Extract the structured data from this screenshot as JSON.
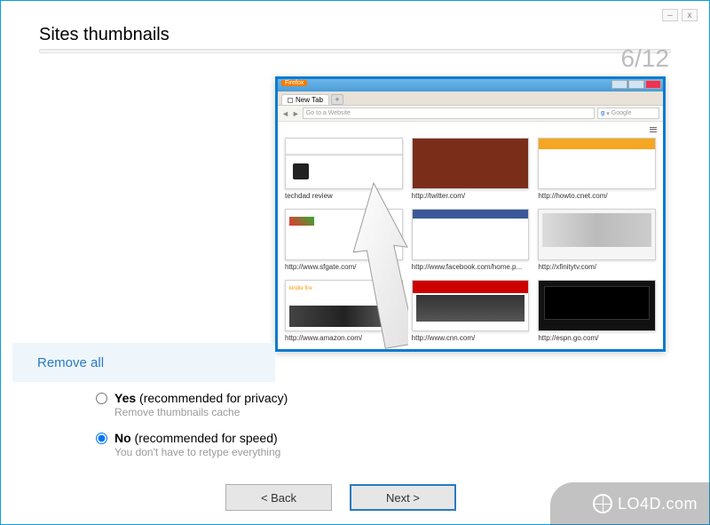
{
  "window": {
    "title": "Sites thumbnails",
    "step_current": 6,
    "step_total": 12,
    "step_display": "6/12"
  },
  "browser": {
    "app_label": "Firefox",
    "tab_label": "New Tab",
    "url_placeholder": "Go to a Website",
    "search_placeholder": "Google",
    "thumbnails": [
      {
        "label": "techdad review"
      },
      {
        "label": "http://twitter.com/"
      },
      {
        "label": "http://howto.cnet.com/"
      },
      {
        "label": "http://www.sfgate.com/"
      },
      {
        "label": "http://www.facebook.com/home.p..."
      },
      {
        "label": "http://xfinitytv.com/"
      },
      {
        "label": "http://www.amazon.com/"
      },
      {
        "label": "http://www.cnn.com/"
      },
      {
        "label": "http://espn.go.com/"
      }
    ]
  },
  "action_bar": {
    "remove_all": "Remove all"
  },
  "options": {
    "yes": {
      "label_strong": "Yes",
      "label_rest": " (recommended for privacy)",
      "sub": "Remove thumbnails cache",
      "selected": false
    },
    "no": {
      "label_strong": "No",
      "label_rest": " (recommended for speed)",
      "sub": "You don't have to retype everything",
      "selected": true
    }
  },
  "buttons": {
    "back": "< Back",
    "next": "Next >"
  },
  "watermark": "LO4D.com"
}
